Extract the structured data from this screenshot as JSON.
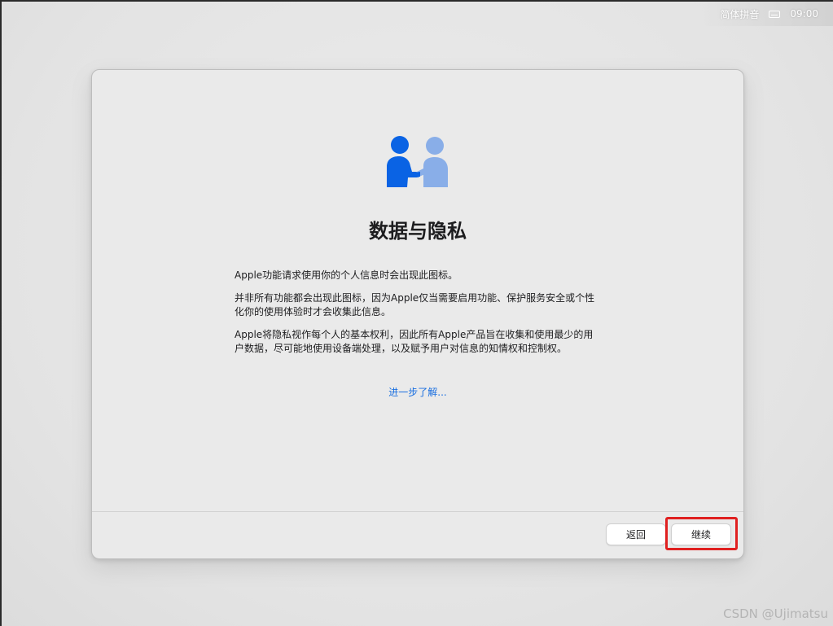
{
  "status_bar": {
    "input_method": "简体拼音",
    "keyboard_icon": "keyboard-icon",
    "time": "09:00"
  },
  "window": {
    "hero_icon": "handshake-people-icon",
    "title": "数据与隐私",
    "paragraphs": [
      "Apple功能请求使用你的个人信息时会出现此图标。",
      "并非所有功能都会出现此图标，因为Apple仅当需要启用功能、保护服务安全或个性化你的使用体验时才会收集此信息。",
      "Apple将隐私视作每个人的基本权利，因此所有Apple产品旨在收集和使用最少的用户数据，尽可能地使用设备端处理，以及赋予用户对信息的知情权和控制权。"
    ],
    "learn_more": "进一步了解...",
    "buttons": {
      "back": "返回",
      "continue": "继续"
    }
  },
  "watermark": "CSDN @Ujimatsu",
  "colors": {
    "accent_link": "#1a6fe0",
    "person_primary": "#0a63e4",
    "person_secondary": "#89aee8",
    "highlight": "#e02020"
  }
}
